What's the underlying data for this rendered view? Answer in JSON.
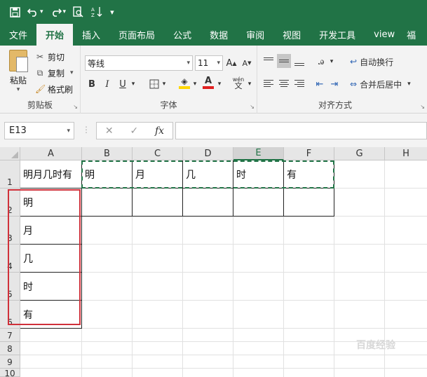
{
  "qat": {
    "save": "save-icon",
    "undo": "undo-icon",
    "redo": "redo-icon",
    "preview": "print-preview-icon",
    "sort": "sort-icon",
    "more": "customize-icon"
  },
  "tabs": [
    "文件",
    "开始",
    "插入",
    "页面布局",
    "公式",
    "数据",
    "审阅",
    "视图",
    "开发工具",
    "view",
    "福"
  ],
  "clipboard": {
    "paste": "粘贴",
    "cut": "剪切",
    "copy": "复制",
    "format_painter": "格式刷",
    "label": "剪贴板"
  },
  "font": {
    "name": "等线",
    "size": "11",
    "grow": "A",
    "shrink": "A",
    "bold": "B",
    "italic": "I",
    "underline": "U",
    "phonetic": "wén",
    "label": "字体"
  },
  "alignment": {
    "wrap": "自动换行",
    "merge": "合并后居中",
    "label": "对齐方式"
  },
  "formula_bar": {
    "name_box": "E13",
    "fx": "fx",
    "formula": ""
  },
  "sheet": {
    "columns": [
      "A",
      "B",
      "C",
      "D",
      "E",
      "F",
      "G",
      "H"
    ],
    "selected_column": "E",
    "rows": [
      "1",
      "2",
      "3",
      "4",
      "5",
      "6",
      "7",
      "8",
      "9",
      "10"
    ],
    "row1": [
      "明月几时有",
      "明",
      "月",
      "几",
      "时",
      "有"
    ],
    "col_a": [
      "明",
      "月",
      "几",
      "时",
      "有"
    ]
  },
  "colors": {
    "accent": "#217346",
    "highlight_red": "#d0303a",
    "fill_yellow": "#ffd700",
    "font_red": "#e02020"
  },
  "watermark": "百度经验"
}
